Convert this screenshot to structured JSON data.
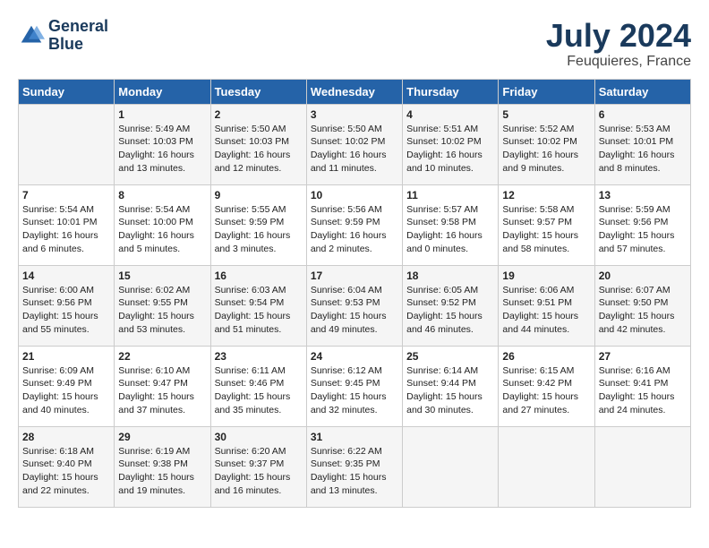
{
  "header": {
    "logo_line1": "General",
    "logo_line2": "Blue",
    "month": "July 2024",
    "location": "Feuquieres, France"
  },
  "weekdays": [
    "Sunday",
    "Monday",
    "Tuesday",
    "Wednesday",
    "Thursday",
    "Friday",
    "Saturday"
  ],
  "weeks": [
    [
      {
        "day": "",
        "content": ""
      },
      {
        "day": "1",
        "content": "Sunrise: 5:49 AM\nSunset: 10:03 PM\nDaylight: 16 hours\nand 13 minutes."
      },
      {
        "day": "2",
        "content": "Sunrise: 5:50 AM\nSunset: 10:03 PM\nDaylight: 16 hours\nand 12 minutes."
      },
      {
        "day": "3",
        "content": "Sunrise: 5:50 AM\nSunset: 10:02 PM\nDaylight: 16 hours\nand 11 minutes."
      },
      {
        "day": "4",
        "content": "Sunrise: 5:51 AM\nSunset: 10:02 PM\nDaylight: 16 hours\nand 10 minutes."
      },
      {
        "day": "5",
        "content": "Sunrise: 5:52 AM\nSunset: 10:02 PM\nDaylight: 16 hours\nand 9 minutes."
      },
      {
        "day": "6",
        "content": "Sunrise: 5:53 AM\nSunset: 10:01 PM\nDaylight: 16 hours\nand 8 minutes."
      }
    ],
    [
      {
        "day": "7",
        "content": "Sunrise: 5:54 AM\nSunset: 10:01 PM\nDaylight: 16 hours\nand 6 minutes."
      },
      {
        "day": "8",
        "content": "Sunrise: 5:54 AM\nSunset: 10:00 PM\nDaylight: 16 hours\nand 5 minutes."
      },
      {
        "day": "9",
        "content": "Sunrise: 5:55 AM\nSunset: 9:59 PM\nDaylight: 16 hours\nand 3 minutes."
      },
      {
        "day": "10",
        "content": "Sunrise: 5:56 AM\nSunset: 9:59 PM\nDaylight: 16 hours\nand 2 minutes."
      },
      {
        "day": "11",
        "content": "Sunrise: 5:57 AM\nSunset: 9:58 PM\nDaylight: 16 hours\nand 0 minutes."
      },
      {
        "day": "12",
        "content": "Sunrise: 5:58 AM\nSunset: 9:57 PM\nDaylight: 15 hours\nand 58 minutes."
      },
      {
        "day": "13",
        "content": "Sunrise: 5:59 AM\nSunset: 9:56 PM\nDaylight: 15 hours\nand 57 minutes."
      }
    ],
    [
      {
        "day": "14",
        "content": "Sunrise: 6:00 AM\nSunset: 9:56 PM\nDaylight: 15 hours\nand 55 minutes."
      },
      {
        "day": "15",
        "content": "Sunrise: 6:02 AM\nSunset: 9:55 PM\nDaylight: 15 hours\nand 53 minutes."
      },
      {
        "day": "16",
        "content": "Sunrise: 6:03 AM\nSunset: 9:54 PM\nDaylight: 15 hours\nand 51 minutes."
      },
      {
        "day": "17",
        "content": "Sunrise: 6:04 AM\nSunset: 9:53 PM\nDaylight: 15 hours\nand 49 minutes."
      },
      {
        "day": "18",
        "content": "Sunrise: 6:05 AM\nSunset: 9:52 PM\nDaylight: 15 hours\nand 46 minutes."
      },
      {
        "day": "19",
        "content": "Sunrise: 6:06 AM\nSunset: 9:51 PM\nDaylight: 15 hours\nand 44 minutes."
      },
      {
        "day": "20",
        "content": "Sunrise: 6:07 AM\nSunset: 9:50 PM\nDaylight: 15 hours\nand 42 minutes."
      }
    ],
    [
      {
        "day": "21",
        "content": "Sunrise: 6:09 AM\nSunset: 9:49 PM\nDaylight: 15 hours\nand 40 minutes."
      },
      {
        "day": "22",
        "content": "Sunrise: 6:10 AM\nSunset: 9:47 PM\nDaylight: 15 hours\nand 37 minutes."
      },
      {
        "day": "23",
        "content": "Sunrise: 6:11 AM\nSunset: 9:46 PM\nDaylight: 15 hours\nand 35 minutes."
      },
      {
        "day": "24",
        "content": "Sunrise: 6:12 AM\nSunset: 9:45 PM\nDaylight: 15 hours\nand 32 minutes."
      },
      {
        "day": "25",
        "content": "Sunrise: 6:14 AM\nSunset: 9:44 PM\nDaylight: 15 hours\nand 30 minutes."
      },
      {
        "day": "26",
        "content": "Sunrise: 6:15 AM\nSunset: 9:42 PM\nDaylight: 15 hours\nand 27 minutes."
      },
      {
        "day": "27",
        "content": "Sunrise: 6:16 AM\nSunset: 9:41 PM\nDaylight: 15 hours\nand 24 minutes."
      }
    ],
    [
      {
        "day": "28",
        "content": "Sunrise: 6:18 AM\nSunset: 9:40 PM\nDaylight: 15 hours\nand 22 minutes."
      },
      {
        "day": "29",
        "content": "Sunrise: 6:19 AM\nSunset: 9:38 PM\nDaylight: 15 hours\nand 19 minutes."
      },
      {
        "day": "30",
        "content": "Sunrise: 6:20 AM\nSunset: 9:37 PM\nDaylight: 15 hours\nand 16 minutes."
      },
      {
        "day": "31",
        "content": "Sunrise: 6:22 AM\nSunset: 9:35 PM\nDaylight: 15 hours\nand 13 minutes."
      },
      {
        "day": "",
        "content": ""
      },
      {
        "day": "",
        "content": ""
      },
      {
        "day": "",
        "content": ""
      }
    ]
  ]
}
